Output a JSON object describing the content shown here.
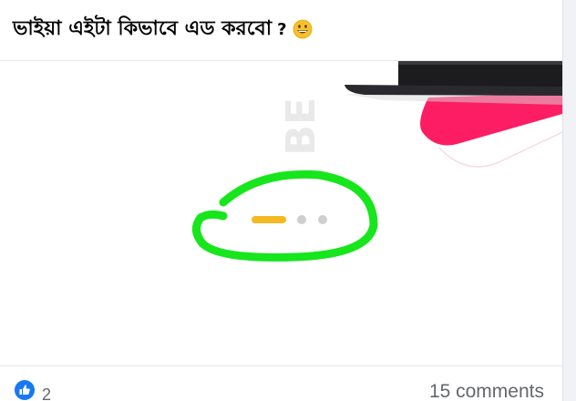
{
  "post": {
    "text": "ভাইয়া এইটা কিভাবে এড করবো",
    "question_mark": "?",
    "emoji": "grinning-face"
  },
  "media": {
    "watermark": "BE",
    "circle_color": "#16e61b",
    "active_dot_color": "#f5b921",
    "inactive_dot_color": "#cfcfcf",
    "accent_color": "#fd1d64"
  },
  "reactions": {
    "count": "2",
    "icon": "like-icon",
    "color": "#1877f2"
  },
  "comments": {
    "label": "15 comments"
  }
}
